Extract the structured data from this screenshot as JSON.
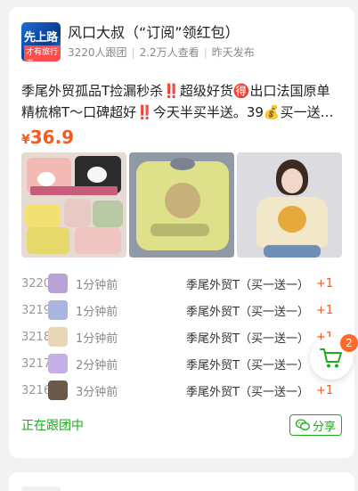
{
  "post": {
    "title": "风口大叔（“订阅”领红包）",
    "avatar_text": "先上路",
    "avatar_subtext": "才有旅行者",
    "followers": "3220人跟团",
    "views": "2.2万人查看",
    "published": "昨天发布",
    "description": "季尾外贸孤品T捡漏秒杀‼️超级好货🉐出口法国原单精梳棉T～口碑超好‼️今天半买半送。39💰买一送…",
    "price_symbol": "¥",
    "price": "36.9"
  },
  "orders": [
    {
      "num": "3220",
      "time": "1分钟前",
      "product": "季尾外贸T（买一送一）",
      "qty": "+1",
      "avatar_color": "#b9a2d8"
    },
    {
      "num": "3219",
      "time": "1分钟前",
      "product": "季尾外贸T（买一送一）",
      "qty": "+1",
      "avatar_color": "#a9b4e0"
    },
    {
      "num": "3218",
      "time": "1分钟前",
      "product": "季尾外贸T（买一送一）",
      "qty": "+1",
      "avatar_color": "#e9d6b8"
    },
    {
      "num": "3217",
      "time": "2分钟前",
      "product": "季尾外贸T（买一送一）",
      "qty": "+1",
      "avatar_color": "#c4b0e6"
    },
    {
      "num": "3216",
      "time": "3分钟前",
      "product": "季尾外贸T（买一送一）",
      "qty": "+1",
      "avatar_color": "#6b5a4a"
    }
  ],
  "footer": {
    "status": "正在跟团中",
    "share_label": "分享"
  },
  "cart": {
    "badge_count": "2"
  },
  "colors": {
    "accent_green": "#1aad19",
    "price_orange": "#f55a1f",
    "badge_orange": "#ff6a2b"
  },
  "icons": {
    "share": "wechat-icon",
    "cart": "cart-icon"
  }
}
